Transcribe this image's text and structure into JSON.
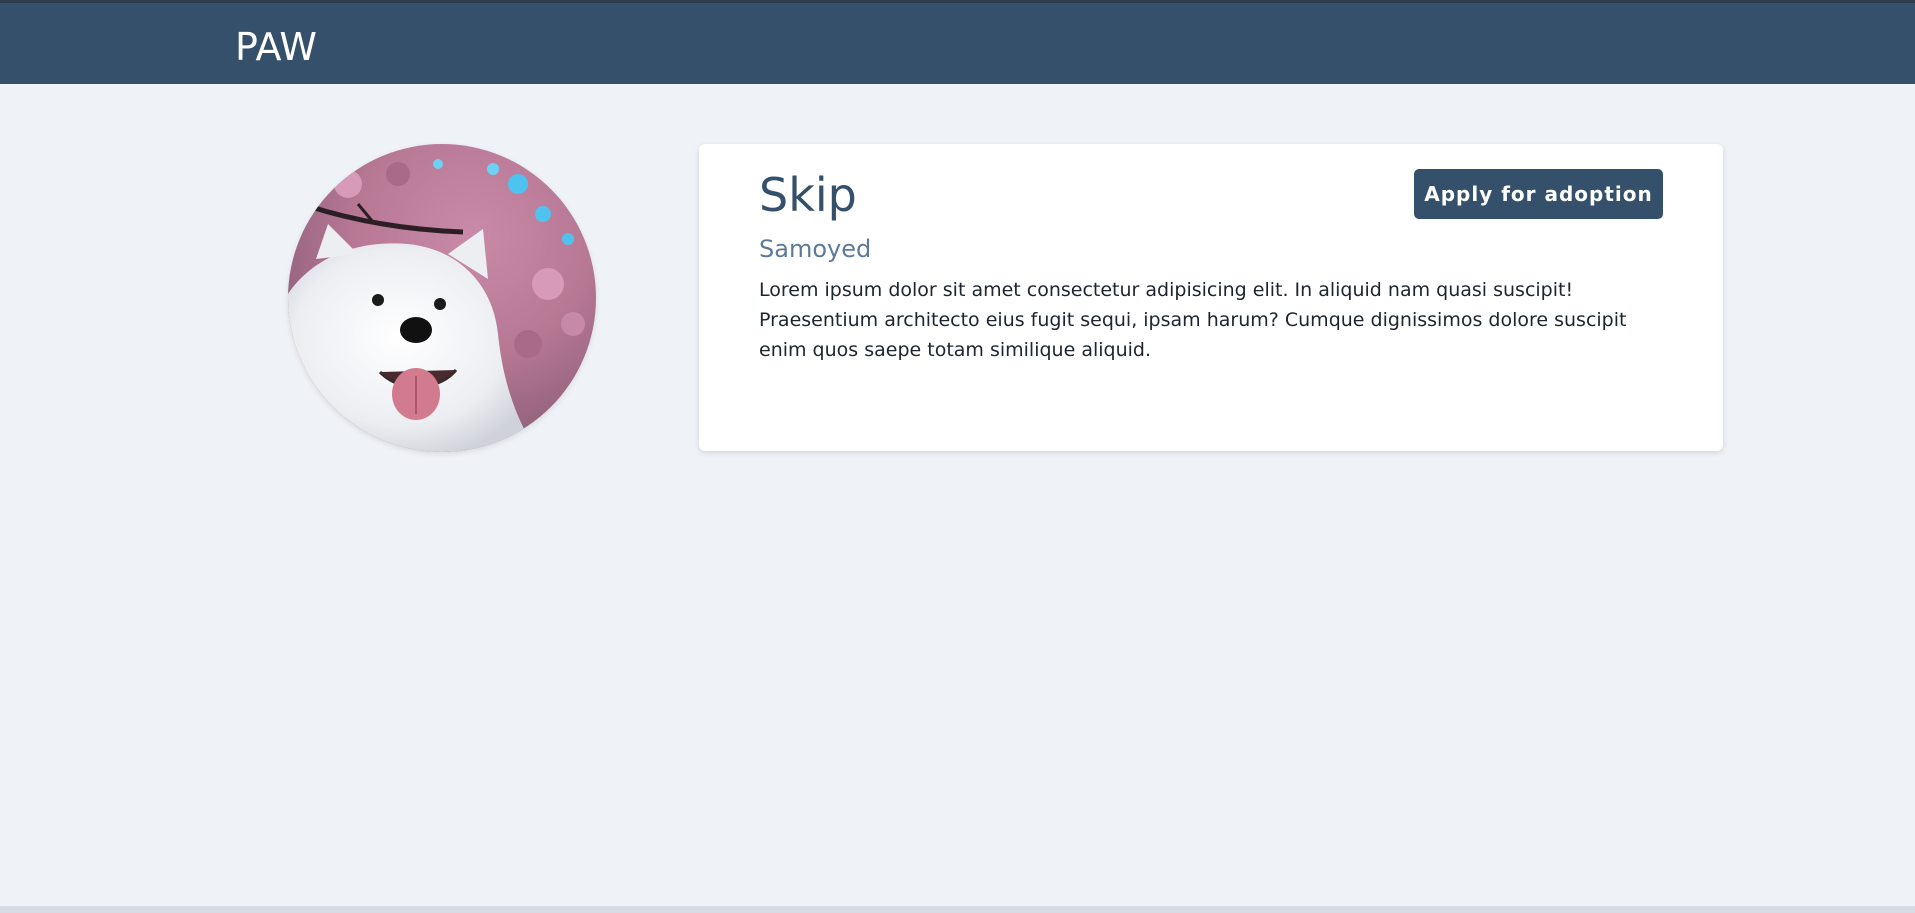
{
  "brand": {
    "name": "PAW"
  },
  "pet": {
    "name": "Skip",
    "breed": "Samoyed",
    "description": "Lorem ipsum dolor sit amet consectetur adipisicing elit. In aliquid nam quasi suscipit! Praesentium architecto eius fugit sequi, ipsam harum? Cumque dignissimos dolore suscipit enim quos saepe totam similique aliquid.",
    "photo_icon": "dog-photo"
  },
  "actions": {
    "apply_label": "Apply for adoption"
  },
  "colors": {
    "navbar": "#34506b",
    "background": "#eff2f7",
    "accent": "#34506b",
    "breed_text": "#5c7a99"
  }
}
